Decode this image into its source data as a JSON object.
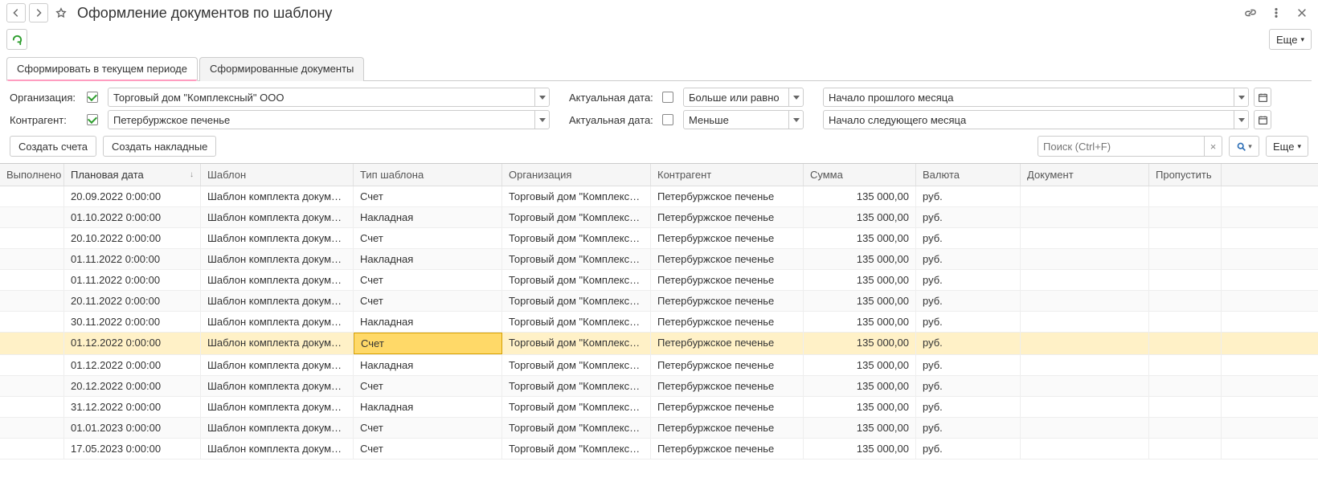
{
  "title": "Оформление документов по шаблону",
  "more": "Еще",
  "tabs": [
    "Сформировать в текущем периоде",
    "Сформированные документы"
  ],
  "filters": {
    "org_label": "Организация:",
    "org_value": "Торговый дом \"Комплексный\" ООО",
    "cp_label": "Контрагент:",
    "cp_value": "Петербуржское печенье",
    "date_label": "Актуальная дата:",
    "op1": "Больше или равно",
    "op2": "Меньше",
    "v1": "Начало прошлого месяца",
    "v2": "Начало следующего месяца"
  },
  "actions": {
    "create_invoices": "Создать счета",
    "create_waybills": "Создать накладные"
  },
  "search_ph": "Поиск (Ctrl+F)",
  "cols": [
    "Выполнено",
    "Плановая дата",
    "Шаблон",
    "Тип шаблона",
    "Организация",
    "Контрагент",
    "Сумма",
    "Валюта",
    "Документ",
    "Пропустить"
  ],
  "rows": [
    {
      "date": "20.09.2022 0:00:00",
      "tpl": "Шаблон комплекта документ...",
      "type": "Счет",
      "org": "Торговый дом \"Комплексный...",
      "cp": "Петербуржское печенье",
      "sum": "135 000,00",
      "cur": "руб."
    },
    {
      "date": "01.10.2022 0:00:00",
      "tpl": "Шаблон комплекта документ...",
      "type": "Накладная",
      "org": "Торговый дом \"Комплексный...",
      "cp": "Петербуржское печенье",
      "sum": "135 000,00",
      "cur": "руб."
    },
    {
      "date": "20.10.2022 0:00:00",
      "tpl": "Шаблон комплекта документ...",
      "type": "Счет",
      "org": "Торговый дом \"Комплексный...",
      "cp": "Петербуржское печенье",
      "sum": "135 000,00",
      "cur": "руб."
    },
    {
      "date": "01.11.2022 0:00:00",
      "tpl": "Шаблон комплекта документ...",
      "type": "Накладная",
      "org": "Торговый дом \"Комплексный...",
      "cp": "Петербуржское печенье",
      "sum": "135 000,00",
      "cur": "руб."
    },
    {
      "date": "01.11.2022 0:00:00",
      "tpl": "Шаблон комплекта документ...",
      "type": "Счет",
      "org": "Торговый дом \"Комплексный...",
      "cp": "Петербуржское печенье",
      "sum": "135 000,00",
      "cur": "руб."
    },
    {
      "date": "20.11.2022 0:00:00",
      "tpl": "Шаблон комплекта документ...",
      "type": "Счет",
      "org": "Торговый дом \"Комплексный...",
      "cp": "Петербуржское печенье",
      "sum": "135 000,00",
      "cur": "руб."
    },
    {
      "date": "30.11.2022 0:00:00",
      "tpl": "Шаблон комплекта документ...",
      "type": "Накладная",
      "org": "Торговый дом \"Комплексный...",
      "cp": "Петербуржское печенье",
      "sum": "135 000,00",
      "cur": "руб."
    },
    {
      "date": "01.12.2022 0:00:00",
      "tpl": "Шаблон комплекта документ...",
      "type": "Счет",
      "org": "Торговый дом \"Комплексный...",
      "cp": "Петербуржское печенье",
      "sum": "135 000,00",
      "cur": "руб.",
      "sel": true
    },
    {
      "date": "01.12.2022 0:00:00",
      "tpl": "Шаблон комплекта документ...",
      "type": "Накладная",
      "org": "Торговый дом \"Комплексный...",
      "cp": "Петербуржское печенье",
      "sum": "135 000,00",
      "cur": "руб."
    },
    {
      "date": "20.12.2022 0:00:00",
      "tpl": "Шаблон комплекта документ...",
      "type": "Счет",
      "org": "Торговый дом \"Комплексный...",
      "cp": "Петербуржское печенье",
      "sum": "135 000,00",
      "cur": "руб."
    },
    {
      "date": "31.12.2022 0:00:00",
      "tpl": "Шаблон комплекта документ...",
      "type": "Накладная",
      "org": "Торговый дом \"Комплексный...",
      "cp": "Петербуржское печенье",
      "sum": "135 000,00",
      "cur": "руб."
    },
    {
      "date": "01.01.2023 0:00:00",
      "tpl": "Шаблон комплекта документ...",
      "type": "Счет",
      "org": "Торговый дом \"Комплексный...",
      "cp": "Петербуржское печенье",
      "sum": "135 000,00",
      "cur": "руб."
    },
    {
      "date": "17.05.2023 0:00:00",
      "tpl": "Шаблон комплекта документ...",
      "type": "Счет",
      "org": "Торговый дом \"Комплексный...",
      "cp": "Петербуржское печенье",
      "sum": "135 000,00",
      "cur": "руб."
    }
  ]
}
